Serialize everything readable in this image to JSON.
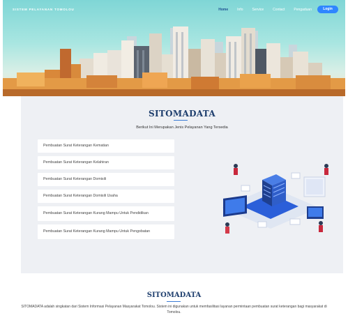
{
  "nav": {
    "brand": "SISTEM PELAYANAN TOMOLOU",
    "links": [
      "Home",
      "Info",
      "Service",
      "Contact",
      "Pengaduan"
    ],
    "login": "Login"
  },
  "services": {
    "title": "SITOMADATA",
    "subtitle": "Berikut Ini Merupakan Jenis Pelayanan Yang Tersedia",
    "items": [
      "Pembuatan Surat Keterangan Kematian",
      "Pembuatan Surat Keterangan Kelahiran",
      "Pembuatan Surat Keterangan Domisili",
      "Pembuatan Surat Keterangan Domisili Usaha",
      "Pembuatan Surat Keterangan Kurang Mampu Untuk Pendidikan",
      "Pembuatan Surat Keterangan Kurang Mampu Untuk Pengobatan"
    ]
  },
  "about": {
    "title": "SITOMADATA",
    "text": "SITOMADATA adalah singkatan dari Sistem Informasi Pelayanan Masyarakat Tomolou. Sistem ini digunakan untuk memfasilitasi layanan permintaan pembuatan surat keterangan bagi masyarakat di Tomolou."
  },
  "colors": {
    "accent": "#2f86ff",
    "heading": "#1f3f6e",
    "section_bg": "#eef0f4"
  }
}
